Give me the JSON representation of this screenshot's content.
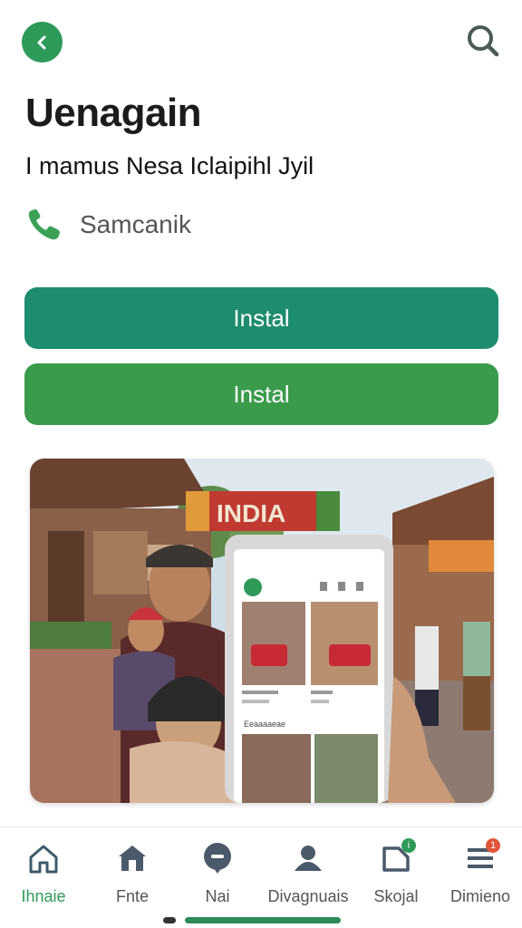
{
  "header": {
    "back_icon": "chevron-left-icon",
    "search_icon": "search-icon",
    "accent": "#2e9a5a"
  },
  "app": {
    "title": "Uenagain",
    "subtitle": "I mamus Nesa Iclaipihl Jyil",
    "contact_label": "Samcanik",
    "contact_icon": "phone-icon"
  },
  "actions": {
    "install_primary": "Instal",
    "install_secondary": "Instal",
    "primary_color": "#1e8c6e",
    "secondary_color": "#3a9b4b"
  },
  "hero": {
    "banner_text": "INDIA",
    "phone_section_label": "Eeaaaaeae"
  },
  "bottom_nav": {
    "items": [
      {
        "label": "Ihnaie",
        "icon": "home-outline-icon",
        "active": true
      },
      {
        "label": "Fnte",
        "icon": "house-filled-icon",
        "active": false
      },
      {
        "label": "Nai",
        "icon": "chat-bubble-icon",
        "active": false
      },
      {
        "label": "Divagnuais",
        "icon": "people-icon",
        "active": false
      },
      {
        "label": "Skojal",
        "icon": "tag-icon",
        "active": false,
        "badge": "i",
        "badge_color": "#2e9a5a"
      },
      {
        "label": "Dimieno",
        "icon": "list-icon",
        "active": false,
        "badge": "1",
        "badge_color": "#e0553a"
      }
    ]
  }
}
